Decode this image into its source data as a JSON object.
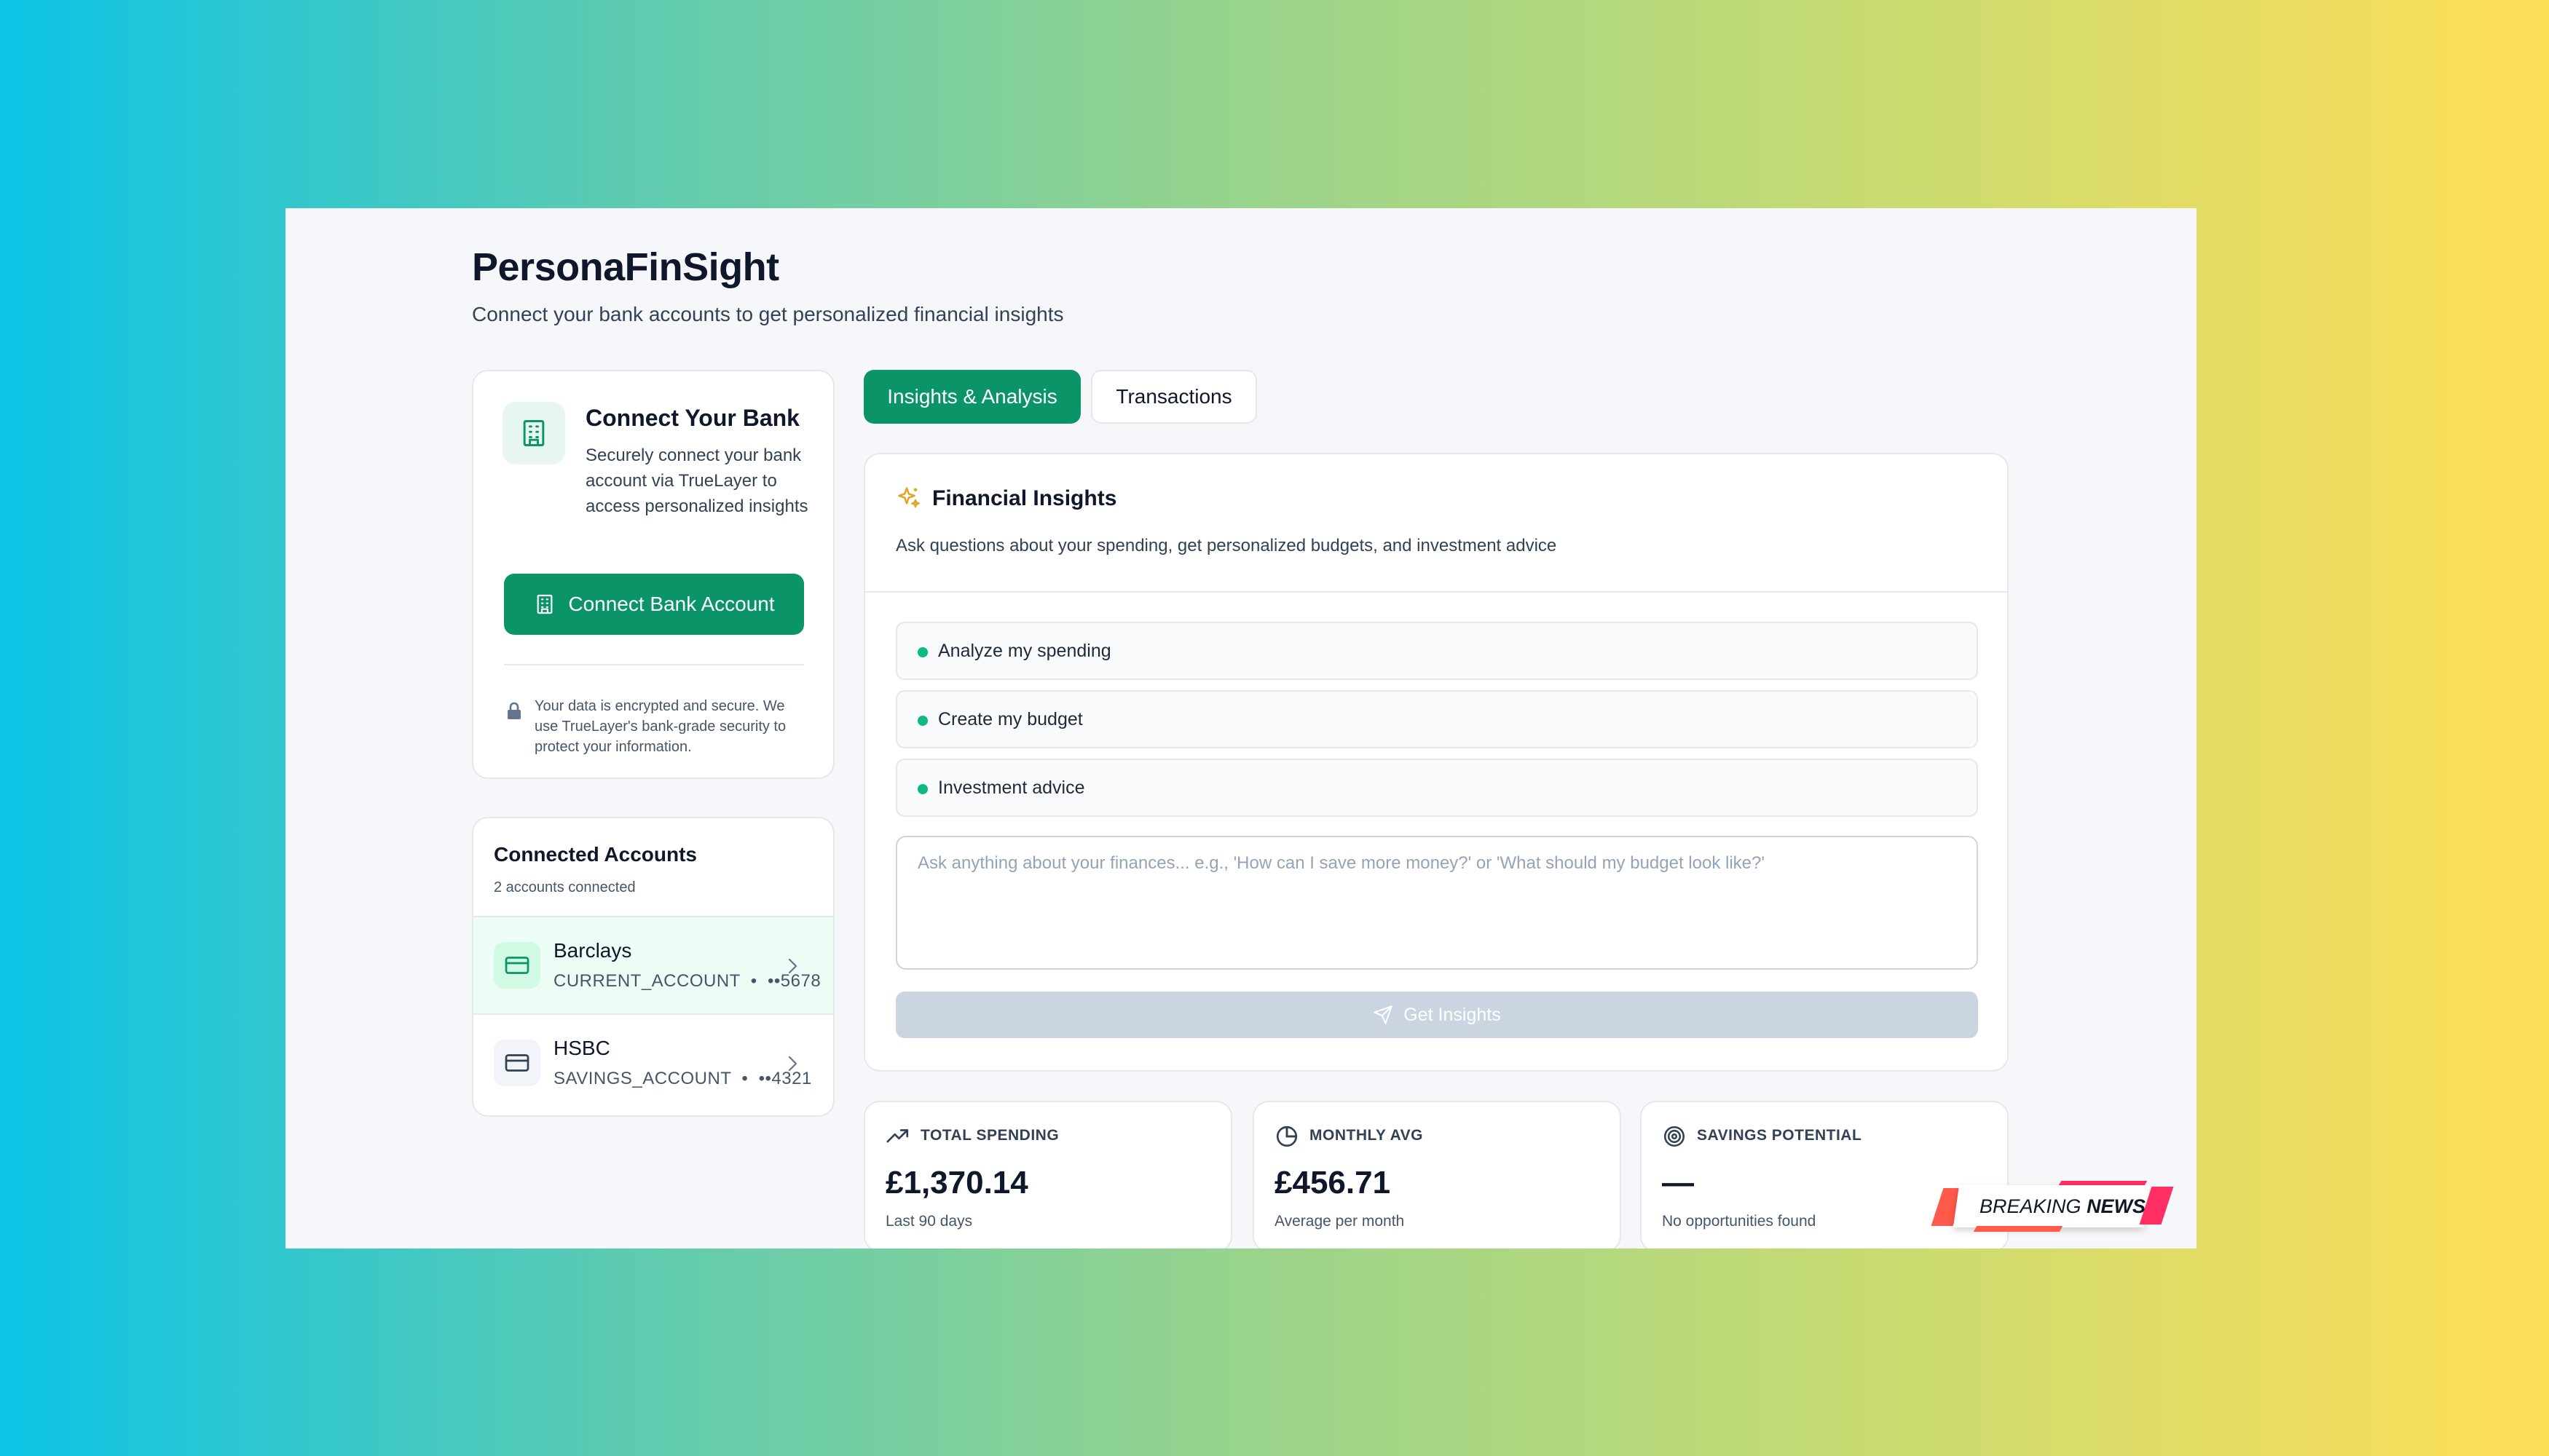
{
  "app": {
    "title": "PersonaFinSight",
    "subtitle": "Connect your bank accounts to get personalized financial insights"
  },
  "connect_card": {
    "icon": "building-icon",
    "title": "Connect Your Bank",
    "description": "Securely connect your bank account via TrueLayer to access personalized insights",
    "button_label": "Connect Bank Account",
    "security_note": "Your data is encrypted and secure. We use TrueLayer's bank-grade security to protect your information."
  },
  "connected_accounts": {
    "title": "Connected Accounts",
    "count_text": "2 accounts connected",
    "items": [
      {
        "name": "Barclays",
        "type": "CURRENT_ACCOUNT",
        "masked": "••5678",
        "selected": true
      },
      {
        "name": "HSBC",
        "type": "SAVINGS_ACCOUNT",
        "masked": "••4321",
        "selected": false
      }
    ]
  },
  "tabs": [
    {
      "label": "Insights & Analysis",
      "active": true
    },
    {
      "label": "Transactions",
      "active": false
    }
  ],
  "insights": {
    "title": "Financial Insights",
    "description": "Ask questions about your spending, get personalized budgets, and investment advice",
    "suggestions": [
      "Analyze my spending",
      "Create my budget",
      "Investment advice"
    ],
    "input_value": "",
    "input_placeholder": "Ask anything about your finances... e.g., 'How can I save more money?' or 'What should my budget look like?'",
    "button_label": "Get Insights"
  },
  "stats": [
    {
      "icon": "trending-up-icon",
      "label": "TOTAL SPENDING",
      "value": "£1,370.14",
      "sub": "Last 90 days"
    },
    {
      "icon": "pie-chart-icon",
      "label": "MONTHLY AVG",
      "value": "£456.71",
      "sub": "Average per month"
    },
    {
      "icon": "target-icon",
      "label": "SAVINGS POTENTIAL",
      "value": "—",
      "sub": "No opportunities found"
    }
  ],
  "badge": {
    "word1": "BREAKING",
    "word2": "NEWS"
  },
  "colors": {
    "primary": "#0b9467",
    "accent_dot": "#10b981",
    "disabled_button": "#cbd5e1",
    "selected_row": "#ecfdf5"
  }
}
